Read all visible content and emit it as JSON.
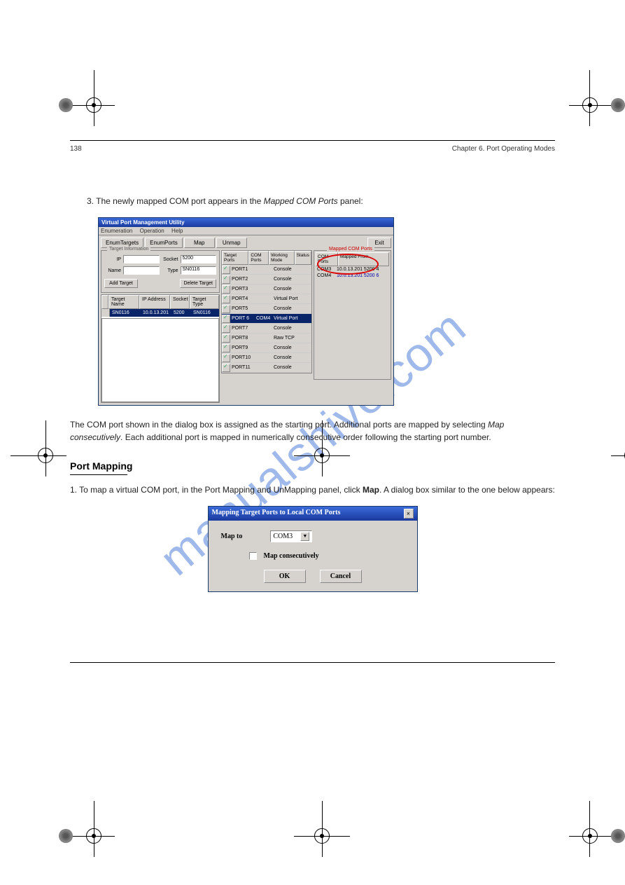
{
  "header": {
    "pageNum": "138",
    "chapter": "Chapter 6. Port Operating Modes"
  },
  "intro": "3. The newly mapped COM port appears in the ",
  "intro_em": "Mapped COM Ports",
  "intro2": " panel:",
  "win": {
    "title": "Virtual Port Management Utility",
    "menu": [
      "Enumeration",
      "Operation",
      "Help"
    ],
    "toolbar": [
      "EnumTargets",
      "EnumPorts",
      "Map",
      "Unmap"
    ],
    "exit": "Exit",
    "group_ti": "Target Information",
    "ip_lbl": "IP",
    "socket_lbl": "Socket",
    "socket_val": "5200",
    "name_lbl": "Name",
    "type_lbl": "Type",
    "type_val": "SN0116",
    "add": "Add Target",
    "del": "Delete Target",
    "targets_head": [
      "Target Name",
      "IP Address",
      "Socket",
      "Target Type"
    ],
    "targets_row": [
      "SN0116",
      "10.0.13.201",
      "5200",
      "SN0116"
    ],
    "ports_head": [
      "Target Ports",
      "COM Ports",
      "Working Mode",
      "Status"
    ],
    "ports": [
      {
        "n": "PORT1",
        "c": "",
        "m": "Console"
      },
      {
        "n": "PORT2",
        "c": "",
        "m": "Console"
      },
      {
        "n": "PORT3",
        "c": "",
        "m": "Console"
      },
      {
        "n": "PORT4",
        "c": "",
        "m": "Virtual Port"
      },
      {
        "n": "PORT5",
        "c": "",
        "m": "Console"
      },
      {
        "n": "PORT 6",
        "c": "COM4",
        "m": "Virtual Port",
        "sel": true
      },
      {
        "n": "PORT7",
        "c": "",
        "m": "Console"
      },
      {
        "n": "PORT8",
        "c": "",
        "m": "Raw TCP"
      },
      {
        "n": "PORT9",
        "c": "",
        "m": "Console"
      },
      {
        "n": "PORT10",
        "c": "",
        "m": "Console"
      },
      {
        "n": "PORT11",
        "c": "",
        "m": "Console"
      }
    ],
    "mapped_title": "Mapped COM Ports",
    "mapped_head": [
      "COM Ports",
      "Mapped From"
    ],
    "mapped_rows": [
      {
        "a": "COM3",
        "b": "10.0.13.201 5200 4"
      },
      {
        "a": "COM4",
        "b": "10.0.13.201 5200 6"
      }
    ]
  },
  "after1": "The COM port shown in the dialog box is assigned as the starting port. Additional ports are mapped by selecting ",
  "after1_em": "Map consecutively",
  "after1b": ". Each additional port is mapped in numerically consecutive order following the starting port number.",
  "heading": "Port Mapping",
  "step1": "1.  To map a virtual COM port, in the Port Mapping and UnMapping panel, click ",
  "step1_em": "Map",
  "step1b": ". A dialog box similar to the one below appears:",
  "dlg": {
    "title": "Mapping Target Ports to Local COM Ports",
    "mapto": "Map to",
    "combo": "COM3",
    "chk": "Map consecutively",
    "ok": "OK",
    "cancel": "Cancel"
  },
  "watermark": "manualshive.com"
}
